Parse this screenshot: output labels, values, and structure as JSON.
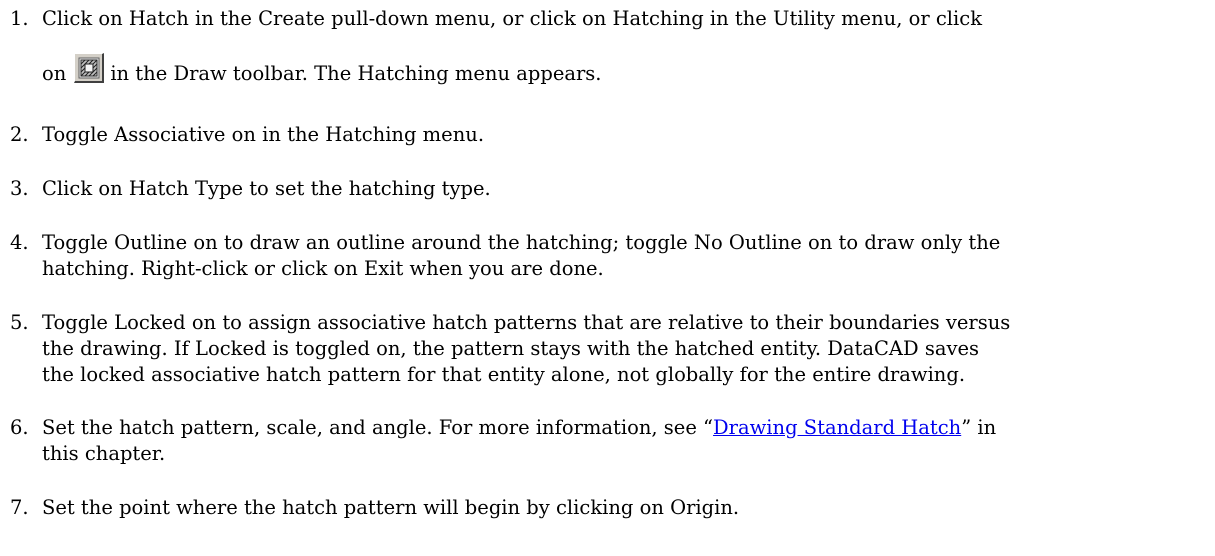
{
  "steps": [
    {
      "number": "1.",
      "line1": "Click on Hatch in the Create pull-down menu, or click on Hatching in the Utility menu, or click",
      "line2_before": "on",
      "icon": "hatch-icon",
      "line2_after": "in the Draw toolbar. The Hatching menu appears."
    },
    {
      "number": "2.",
      "text": "Toggle Associative on in the Hatching menu."
    },
    {
      "number": "3.",
      "text": "Click on Hatch Type to set the hatching type."
    },
    {
      "number": "4.",
      "line1": "Toggle Outline on to draw an outline around the hatching; toggle No Outline on to draw only the",
      "line2": "hatching. Right-click or click on Exit when you are done."
    },
    {
      "number": "5.",
      "line1": "Toggle Locked on to assign associative hatch patterns that are relative to their boundaries versus",
      "line2": "the drawing. If Locked is toggled on, the pattern stays with the hatched entity. DataCAD saves",
      "line3": "the locked associative hatch pattern for that entity alone, not globally for the entire drawing."
    },
    {
      "number": "6.",
      "line1_before": "Set the hatch pattern, scale, and angle. For more information, see “",
      "link_text": "Drawing Standard Hatch",
      "line1_after": "” in",
      "line2": "this chapter."
    },
    {
      "number": "7.",
      "text": "Set the point where the hatch pattern will begin by clicking on Origin."
    }
  ],
  "colors": {
    "text": "#000000",
    "link": "#0000ee",
    "button_face": "#d4d0c8"
  }
}
